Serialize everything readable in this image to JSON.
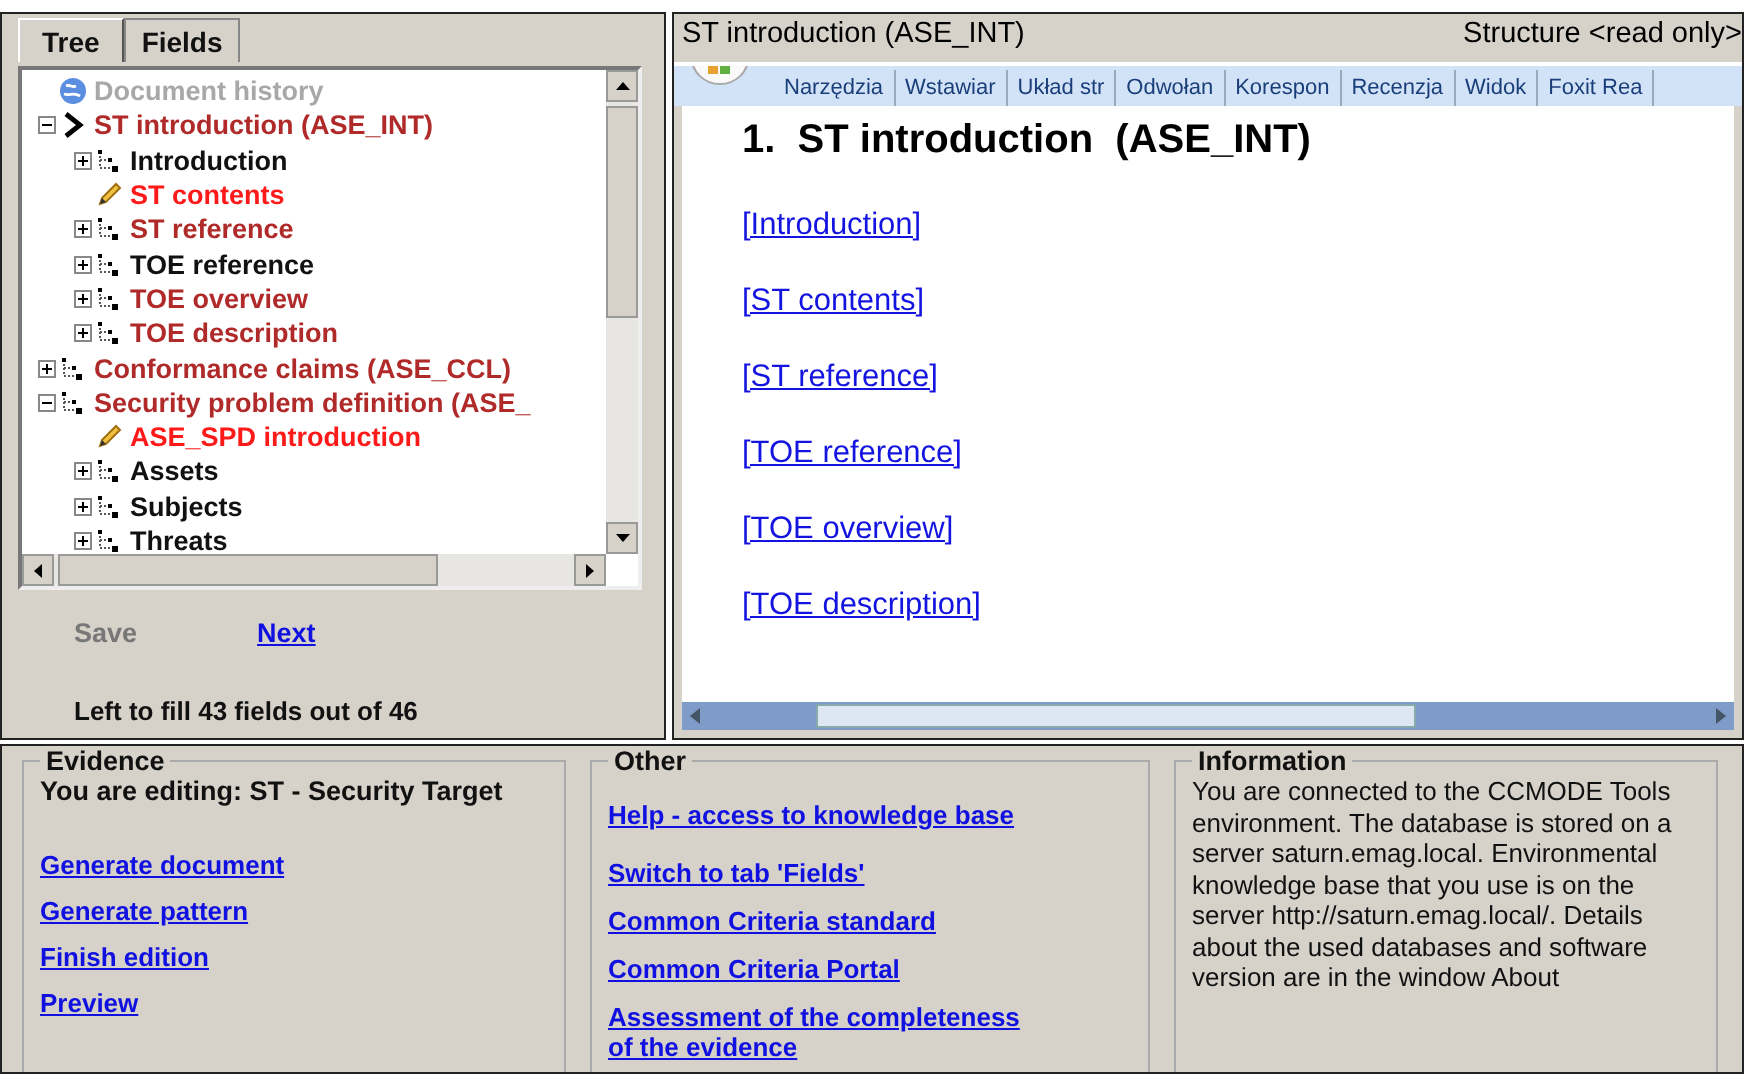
{
  "left_tabs": [
    {
      "label": "Tree",
      "selected": true
    },
    {
      "label": "Fields",
      "selected": false
    }
  ],
  "tree": {
    "items": [
      {
        "label": "Document history",
        "kind": "globe",
        "color": "#a8a8a8"
      },
      {
        "label": "ST introduction (ASE_INT)",
        "kind": "arrow",
        "color": "#b02a2a",
        "expanded": true,
        "children": [
          {
            "label": "Introduction",
            "kind": "tree",
            "color": "#111111",
            "expanded": false
          },
          {
            "label": "ST contents",
            "kind": "pencil",
            "color": "#ff1a1a"
          },
          {
            "label": "ST reference",
            "kind": "tree",
            "color": "#b02a2a",
            "expanded": false
          },
          {
            "label": "TOE reference",
            "kind": "tree",
            "color": "#111111",
            "expanded": false
          },
          {
            "label": "TOE overview",
            "kind": "tree",
            "color": "#b02a2a",
            "expanded": false
          },
          {
            "label": "TOE description",
            "kind": "tree",
            "color": "#b02a2a",
            "expanded": false
          }
        ]
      },
      {
        "label": "Conformance claims (ASE_CCL)",
        "kind": "tree",
        "color": "#b02a2a",
        "expanded": false
      },
      {
        "label": "Security problem definition (ASE_",
        "kind": "tree",
        "color": "#b02a2a",
        "expanded": true,
        "children": [
          {
            "label": "ASE_SPD introduction",
            "kind": "pencil",
            "color": "#ff1a1a"
          },
          {
            "label": "Assets",
            "kind": "tree",
            "color": "#111111",
            "expanded": false
          },
          {
            "label": "Subjects",
            "kind": "tree",
            "color": "#111111",
            "expanded": false
          },
          {
            "label": "Threats",
            "kind": "tree",
            "color": "#111111",
            "expanded": false
          }
        ]
      }
    ]
  },
  "actions": [
    {
      "label": "Save",
      "disabled": true
    },
    {
      "label": "Next",
      "disabled": false
    }
  ],
  "fill_status": "Left to fill 43 fields out of 46",
  "document": {
    "title": "ST introduction (ASE_INT)",
    "mode": "Structure <read only>",
    "ribbon_tabs": [
      "Narzędzia",
      "Wstawiar",
      "Układ str",
      "Odwołan",
      "Korespon",
      "Recenzja",
      "Widok",
      "Foxit Rea"
    ],
    "heading": "1.  ST introduction  (ASE_INT)",
    "links": [
      "[Introduction]",
      "[ST contents]",
      "[ST reference]",
      "[TOE reference]",
      "[TOE overview]",
      "[TOE description]"
    ]
  },
  "evidence": {
    "title": "Evidence",
    "editing": "You are editing: ST - Security Target",
    "links": [
      "Generate document",
      "Generate pattern",
      "Finish edition",
      "Preview"
    ]
  },
  "other": {
    "title": "Other",
    "links": [
      "Help - access to knowledge base",
      "Switch to tab 'Fields'",
      "Common Criteria standard",
      "Common Criteria Portal",
      "Assessment of the completeness of the evidence"
    ]
  },
  "information": {
    "title": "Information",
    "text": "You are connected to the CCMODE Tools environment. The database is stored on a server saturn.emag.local. Environmental knowledge base that you use is on the server http://saturn.emag.local/. Details about the used databases and software version are in the window About"
  }
}
